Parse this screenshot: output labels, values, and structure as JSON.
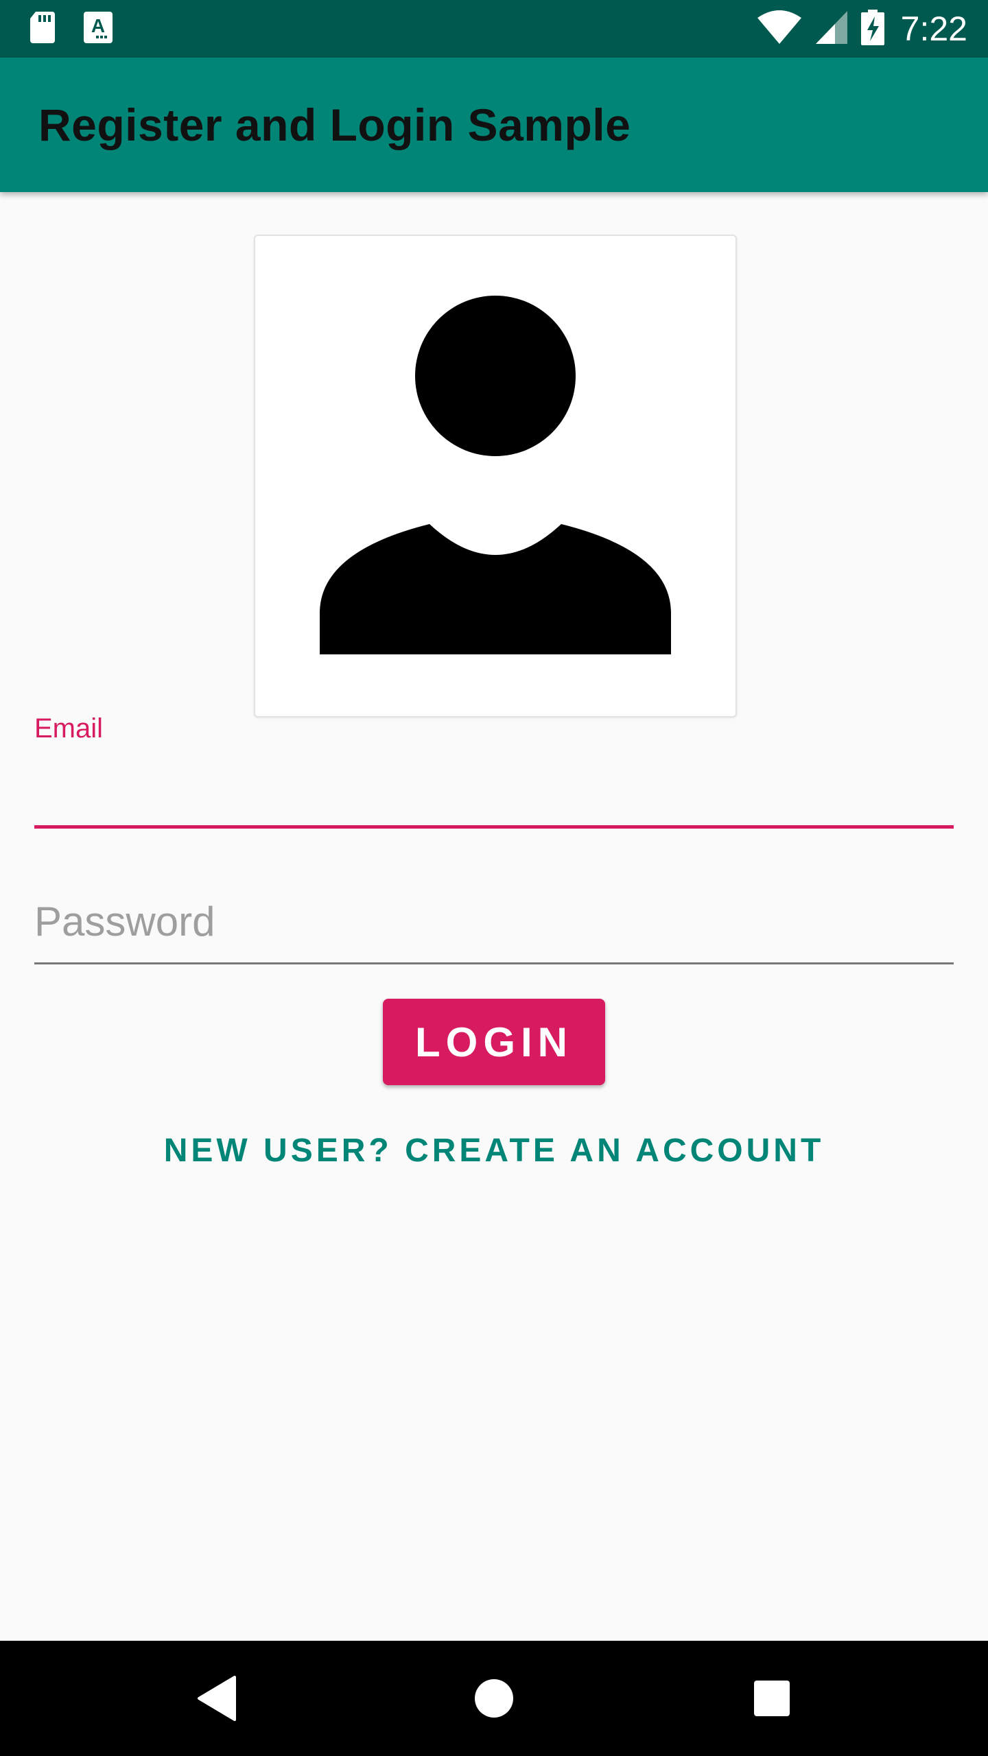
{
  "status_bar": {
    "time": "7:22",
    "left_icons": [
      "sd-card-icon",
      "app-notification-icon"
    ],
    "right_icons": [
      "wifi-icon",
      "cell-signal-icon",
      "battery-charging-icon"
    ]
  },
  "app_bar": {
    "title": "Register and Login Sample"
  },
  "avatar": {
    "icon": "person-icon"
  },
  "form": {
    "email_label": "Email",
    "email_value": "",
    "password_placeholder": "Password",
    "password_value": "",
    "login_label": "LOGIN",
    "create_account_label": "NEW USER? CREATE AN ACCOUNT"
  },
  "colors": {
    "primary": "#008577",
    "primary_dark": "#00594f",
    "accent": "#d81b60",
    "background": "#fafafa"
  },
  "nav_bar": {
    "icons": [
      "back-icon",
      "home-icon",
      "recents-icon"
    ]
  }
}
